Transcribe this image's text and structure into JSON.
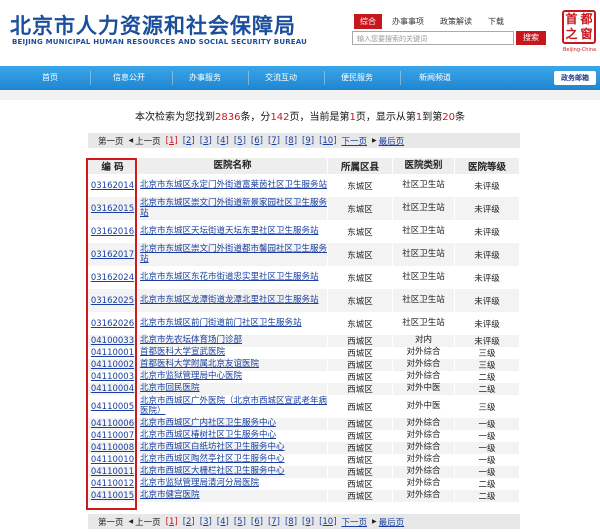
{
  "header": {
    "site_title": "北京市人力资源和社会保障局",
    "site_title_en": "BEIJING MUNICIPAL HUMAN RESOURCES AND SOCIAL SECURITY BUREAU",
    "top_links": [
      "综合",
      "办事事项",
      "政策解读",
      "下载"
    ],
    "search_placeholder": "输入您要搜索的关键词",
    "search_button": "搜索",
    "seal_chars": [
      "首",
      "都",
      "之",
      "窗"
    ],
    "seal_en": "Beijing-China"
  },
  "nav": {
    "items": [
      "首页",
      "信息公开",
      "办事服务",
      "交流互动",
      "便民服务",
      "新闻频道"
    ],
    "mail": "政务邮箱"
  },
  "summary": {
    "prefix": "本次检索为您找到",
    "total": "2836",
    "mid1": "条，分",
    "pages": "142",
    "mid2": "页，当前是第",
    "current": "1",
    "mid3": "页，显示从第",
    "from": "1",
    "mid4": "到第",
    "to": "20",
    "suffix": "条"
  },
  "pager": {
    "first": "第一页",
    "prev": "上一页",
    "pages": [
      "[1]",
      "[2]",
      "[3]",
      "[4]",
      "[5]",
      "[6]",
      "[7]",
      "[8]",
      "[9]",
      "[10]"
    ],
    "next": "下一页",
    "last": "最后页"
  },
  "table": {
    "headers": [
      "编  码",
      "医院名称",
      "所属区县",
      "医院类别",
      "医院等级"
    ],
    "rows": [
      {
        "code": "03162014",
        "name": "北京市东城区永定门外街道富莱茵社区卫生服务站",
        "area": "东城区",
        "type": "社区卫生站",
        "level": "未评级"
      },
      {
        "code": "03162015",
        "name": "北京市东城区崇文门外街道新景家园社区卫生服务站",
        "area": "东城区",
        "type": "社区卫生站",
        "level": "未评级"
      },
      {
        "code": "03162016",
        "name": "北京市东城区天坛街道天坛东里社区卫生服务站",
        "area": "东城区",
        "type": "社区卫生站",
        "level": "未评级"
      },
      {
        "code": "03162017",
        "name": "北京市东城区崇文门外街道都市馨园社区卫生服务站",
        "area": "东城区",
        "type": "社区卫生站",
        "level": "未评级"
      },
      {
        "code": "03162024",
        "name": "北京市东城区东花市街道忠实里社区卫生服务站",
        "area": "东城区",
        "type": "社区卫生站",
        "level": "未评级"
      },
      {
        "code": "03162025",
        "name": "北京市东城区龙潭街道龙潭北里社区卫生服务站",
        "area": "东城区",
        "type": "社区卫生站",
        "level": "未评级"
      },
      {
        "code": "03162026",
        "name": "北京市东城区前门街道前门社区卫生服务站",
        "area": "东城区",
        "type": "社区卫生站",
        "level": "未评级"
      },
      {
        "code": "04100033",
        "name": "北京市先农坛体育场门诊部",
        "area": "西城区",
        "type": "对内",
        "level": "未评级"
      },
      {
        "code": "04110001",
        "name": "首都医科大学宣武医院",
        "area": "西城区",
        "type": "对外综合",
        "level": "三级"
      },
      {
        "code": "04110002",
        "name": "首都医科大学附属北京友谊医院",
        "area": "西城区",
        "type": "对外综合",
        "level": "三级"
      },
      {
        "code": "04110003",
        "name": "北京市监狱管理局中心医院",
        "area": "西城区",
        "type": "对外综合",
        "level": "二级"
      },
      {
        "code": "04110004",
        "name": "北京市回民医院",
        "area": "西城区",
        "type": "对外中医",
        "level": "二级"
      },
      {
        "code": "04110005",
        "name": "北京市西城区广外医院（北京市西城区宣武老年病医院）",
        "area": "西城区",
        "type": "对外中医",
        "level": "三级"
      },
      {
        "code": "04110006",
        "name": "北京市西城区广内社区卫生服务中心",
        "area": "西城区",
        "type": "对外综合",
        "level": "一级"
      },
      {
        "code": "04110007",
        "name": "北京市西城区椿树社区卫生服务中心",
        "area": "西城区",
        "type": "对外综合",
        "level": "一级"
      },
      {
        "code": "04110008",
        "name": "北京市西城区白纸坊社区卫生服务中心",
        "area": "西城区",
        "type": "对外综合",
        "level": "一级"
      },
      {
        "code": "04110010",
        "name": "北京市西城区陶然亭社区卫生服务中心",
        "area": "西城区",
        "type": "对外综合",
        "level": "一级"
      },
      {
        "code": "04110011",
        "name": "北京市西城区大栅栏社区卫生服务中心",
        "area": "西城区",
        "type": "对外综合",
        "level": "一级"
      },
      {
        "code": "04110012",
        "name": "北京市监狱管理局清河分局医院",
        "area": "西城区",
        "type": "对外综合",
        "level": "二级"
      },
      {
        "code": "04110015",
        "name": "北京市健宫医院",
        "area": "西城区",
        "type": "对外综合",
        "level": "二级"
      }
    ]
  }
}
